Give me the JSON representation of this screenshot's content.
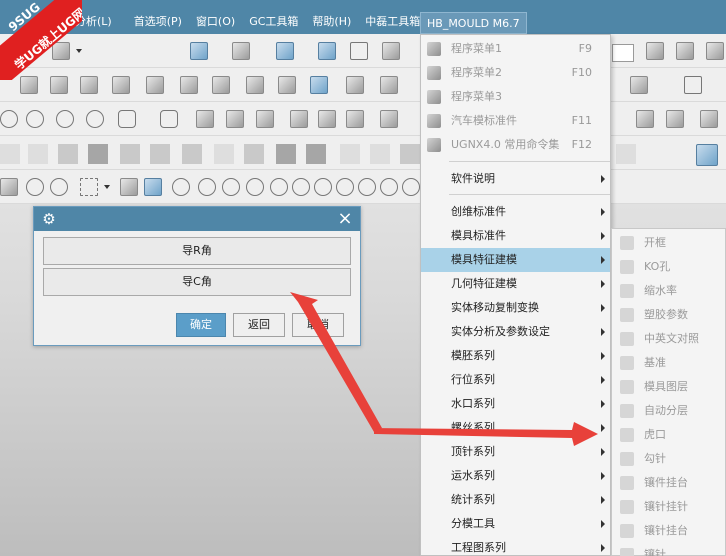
{
  "menubar": {
    "items": [
      "分析(L)",
      "首选项(P)",
      "窗口(O)",
      "GC工具箱",
      "帮助(H)",
      "中磊工具箱"
    ],
    "active_menu": "HB_MOULD M6.7"
  },
  "logo": {
    "line1": "9SUG",
    "line2": "学UG就上UG网"
  },
  "dialog": {
    "button_r": "导R角",
    "button_c": "导C角",
    "ok": "确定",
    "back": "返回",
    "cancel": "取消"
  },
  "dropdown": {
    "top_items": [
      {
        "label": "程序菜单1",
        "accel": "F9"
      },
      {
        "label": "程序菜单2",
        "accel": "F10"
      },
      {
        "label": "程序菜单3",
        "accel": ""
      },
      {
        "label": "汽车模标准件",
        "accel": "F11"
      },
      {
        "label": "UGNX4.0 常用命令集",
        "accel": "F12"
      }
    ],
    "help_item": "软件说明",
    "sub_items": [
      "创维标准件",
      "模具标准件",
      "模具特征建模",
      "几何特征建模",
      "实体移动复制变换",
      "实体分析及参数设定",
      "模胚系列",
      "行位系列",
      "水口系列",
      "螺丝系列",
      "顶针系列",
      "运水系列",
      "统计系列",
      "分模工具",
      "工程图系列"
    ],
    "highlighted": "模具特征建模"
  },
  "submenu": {
    "items": [
      "开框",
      "KO孔",
      "缩水率",
      "塑胶参数",
      "中英文对照",
      "基准",
      "模具图层",
      "自动分层",
      "虎口",
      "勾针",
      "镶件挂台",
      "镶针挂针",
      "镶针挂台",
      "镶针"
    ]
  },
  "colors": {
    "titlebar": "#4f86a7",
    "highlight": "#a9d2e8",
    "arrow": "#e8413a"
  }
}
